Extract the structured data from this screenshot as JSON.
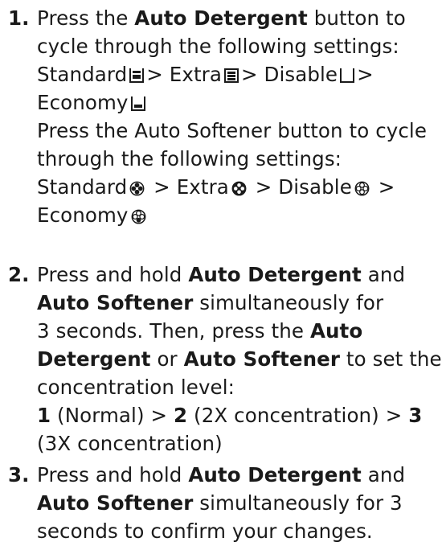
{
  "steps": [
    {
      "number": "1.",
      "detergent": {
        "intro_pre": "Press the ",
        "button": "Auto Detergent",
        "intro_post": " button to",
        "line2": "cycle through the following settings:",
        "standard": "Standard",
        "extra": "Extra",
        "disable": "Disable",
        "economy": "Economy",
        "sep": ">"
      },
      "softener": {
        "line1": "Press the Auto Softener button to cycle",
        "line2": "through the following settings:",
        "standard": "Standard",
        "extra": "Extra",
        "disable": "Disable",
        "economy": "Economy",
        "sep": ">"
      },
      "icons": [
        "detergent-standard-icon",
        "detergent-extra-icon",
        "detergent-disable-icon",
        "detergent-economy-icon",
        "softener-standard-icon",
        "softener-extra-icon",
        "softener-disable-icon",
        "softener-economy-icon"
      ]
    },
    {
      "number": "2.",
      "l1_pre": "Press and hold ",
      "l1_b": "Auto Detergent",
      "l1_post": " and",
      "l2_b": "Auto Softener",
      "l2_post": " simultaneously for",
      "l3_pre": "3 seconds. Then, press the ",
      "l3_b": "Auto",
      "l4_b1": "Detergent",
      "l4_mid": " or ",
      "l4_b2": "Auto Softener",
      "l4_post": " to set the",
      "l5": "concentration level:",
      "l6_b1": "1",
      "l6_t1": " (Normal) > ",
      "l6_b2": "2",
      "l6_t2": " (2X concentration) > ",
      "l6_b3": "3",
      "l7": "(3X concentration)"
    },
    {
      "number": "3.",
      "l1_pre": "Press and hold ",
      "l1_b": "Auto Detergent",
      "l1_post": " and",
      "l2_b": "Auto Softener",
      "l2_post": " simultaneously for 3",
      "l3": "seconds to confirm your changes."
    }
  ]
}
